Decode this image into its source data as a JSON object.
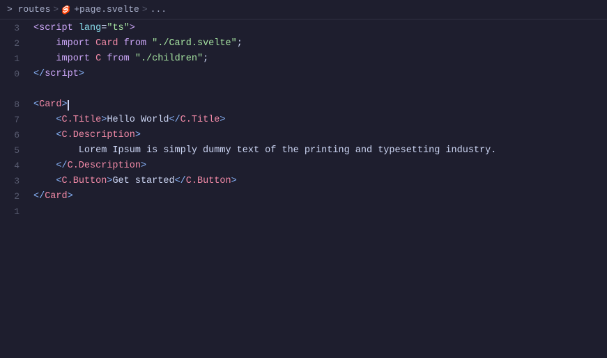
{
  "breadcrumb": {
    "parts": [
      {
        "label": "> routes",
        "type": "text"
      },
      {
        "label": ">",
        "type": "sep"
      },
      {
        "label": "+page.svelte",
        "type": "svelte"
      },
      {
        "label": ">",
        "type": "sep"
      },
      {
        "label": "...",
        "type": "text"
      }
    ]
  },
  "lines": [
    {
      "num": "3",
      "tokens": [
        {
          "t": "kw",
          "v": "<script"
        },
        {
          "t": "text",
          "v": " "
        },
        {
          "t": "attr",
          "v": "lang"
        },
        {
          "t": "punct",
          "v": "="
        },
        {
          "t": "str",
          "v": "\"ts\""
        },
        {
          "t": "kw",
          "v": ">"
        }
      ]
    },
    {
      "num": "2",
      "tokens": [
        {
          "t": "text",
          "v": "    "
        },
        {
          "t": "kw",
          "v": "import"
        },
        {
          "t": "text",
          "v": " "
        },
        {
          "t": "comp-name",
          "v": "Card"
        },
        {
          "t": "text",
          "v": " "
        },
        {
          "t": "kw",
          "v": "from"
        },
        {
          "t": "text",
          "v": " "
        },
        {
          "t": "str",
          "v": "\"./Card.svelte\""
        }
      ]
    },
    {
      "num": "1",
      "tokens": [
        {
          "t": "text",
          "v": "    "
        },
        {
          "t": "kw",
          "v": "import"
        },
        {
          "t": "text",
          "v": " "
        },
        {
          "t": "comp-name",
          "v": "C"
        },
        {
          "t": "text",
          "v": " "
        },
        {
          "t": "kw",
          "v": "from"
        },
        {
          "t": "text",
          "v": " "
        },
        {
          "t": "str",
          "v": "\"./children\""
        }
      ]
    },
    {
      "num": "0",
      "tokens": [
        {
          "t": "tag",
          "v": "</"
        },
        {
          "t": "kw",
          "v": "script"
        },
        {
          "t": "tag",
          "v": ">"
        }
      ]
    },
    {
      "num": "",
      "tokens": []
    },
    {
      "num": "8",
      "tokens": [
        {
          "t": "tag",
          "v": "<"
        },
        {
          "t": "comp-name",
          "v": "Card"
        },
        {
          "t": "tag",
          "v": ">"
        }
      ],
      "cursor_after": 2
    },
    {
      "num": "7",
      "tokens": [
        {
          "t": "text",
          "v": "    "
        },
        {
          "t": "tag",
          "v": "<"
        },
        {
          "t": "comp-name",
          "v": "C.Title"
        },
        {
          "t": "tag",
          "v": ">"
        },
        {
          "t": "text-content",
          "v": "Hello World"
        },
        {
          "t": "tag",
          "v": "</"
        },
        {
          "t": "comp-name",
          "v": "C.Title"
        },
        {
          "t": "tag",
          "v": ">"
        }
      ]
    },
    {
      "num": "6",
      "tokens": [
        {
          "t": "text",
          "v": "    "
        },
        {
          "t": "tag",
          "v": "<"
        },
        {
          "t": "comp-name",
          "v": "C.Description"
        },
        {
          "t": "tag",
          "v": ">"
        }
      ]
    },
    {
      "num": "5",
      "tokens": [
        {
          "t": "text",
          "v": "        Lorem Ipsum is simply dummy text of "
        },
        {
          "t": "highlight",
          "v": "the"
        },
        {
          "t": "text",
          "v": " printing and typesetting industry."
        }
      ]
    },
    {
      "num": "4",
      "tokens": [
        {
          "t": "text",
          "v": "    "
        },
        {
          "t": "tag",
          "v": "</"
        },
        {
          "t": "comp-name",
          "v": "C.Description"
        },
        {
          "t": "tag",
          "v": ">"
        }
      ]
    },
    {
      "num": "3",
      "tokens": [
        {
          "t": "text",
          "v": "    "
        },
        {
          "t": "tag",
          "v": "<"
        },
        {
          "t": "comp-name",
          "v": "C.Button"
        },
        {
          "t": "tag",
          "v": ">"
        },
        {
          "t": "text-content",
          "v": "Get started"
        },
        {
          "t": "tag",
          "v": "</"
        },
        {
          "t": "comp-name",
          "v": "C.Button"
        },
        {
          "t": "tag",
          "v": ">"
        }
      ]
    },
    {
      "num": "2",
      "tokens": [
        {
          "t": "tag",
          "v": "</"
        },
        {
          "t": "comp-name",
          "v": "Card"
        },
        {
          "t": "tag",
          "v": ">"
        }
      ]
    },
    {
      "num": "1",
      "tokens": []
    },
    {
      "num": "",
      "tokens": []
    }
  ]
}
